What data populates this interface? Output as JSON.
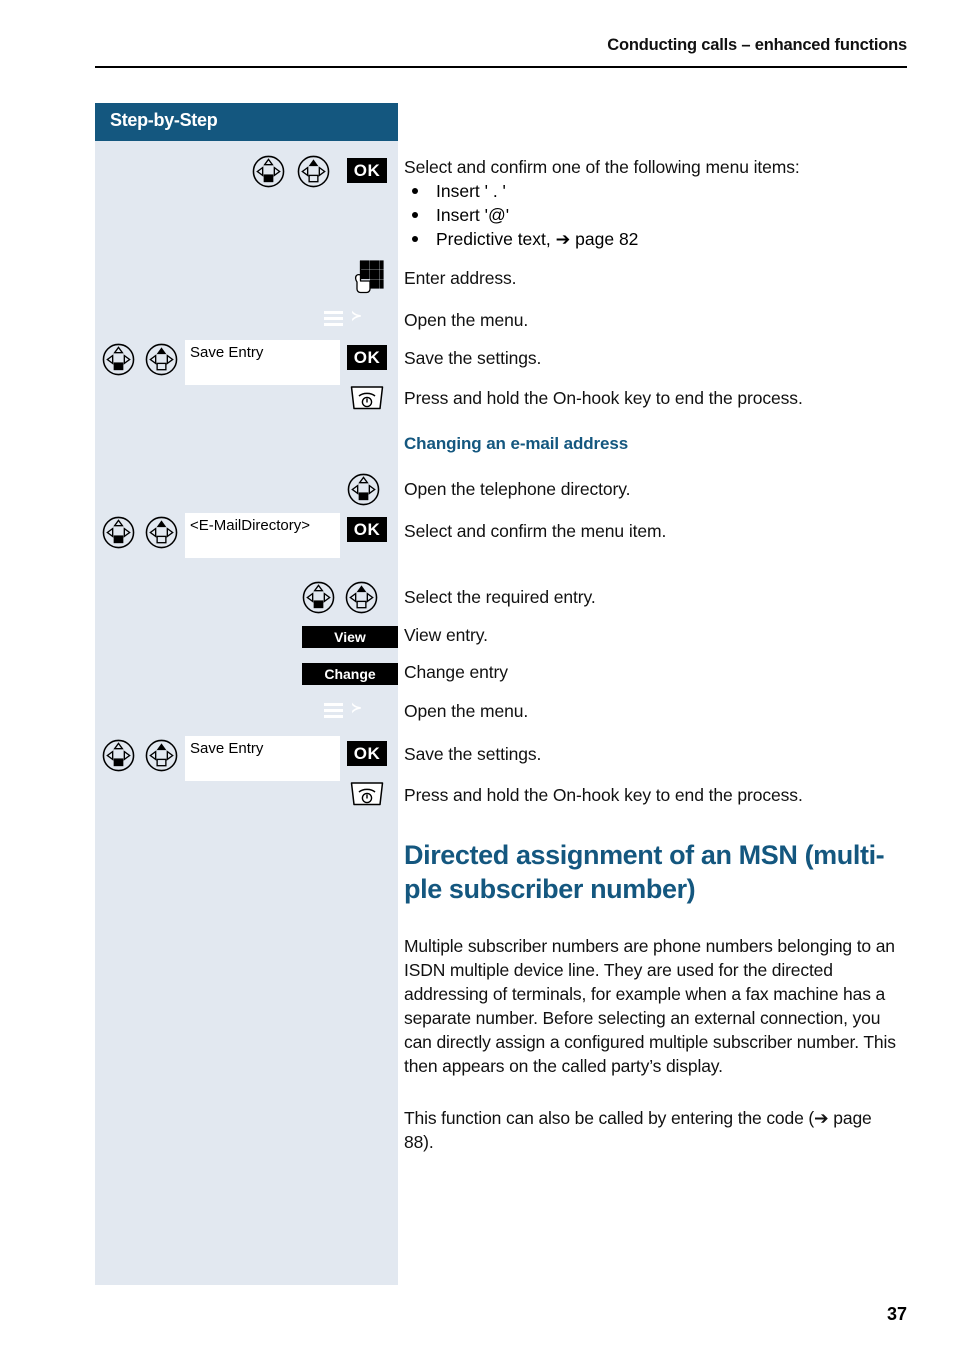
{
  "header": {
    "running_title": "Conducting calls – enhanced functions"
  },
  "sidebar": {
    "title": "Step-by-Step",
    "rows": [
      {
        "icons": [
          "nav-key-outline-up",
          "nav-key-filled-up",
          "ok-key"
        ],
        "display": "",
        "label": "OK"
      },
      {
        "icons": [
          "keypad-key"
        ]
      },
      {
        "icons": [
          "menu-key"
        ]
      },
      {
        "icons": [
          "nav-key-outline-up",
          "nav-key-filled-up",
          "display-field",
          "ok-key"
        ],
        "display": "Save Entry",
        "label": "OK"
      },
      {
        "icons": [
          "on-hook-key"
        ]
      },
      {
        "icons": [
          "nav-key-outline-up"
        ]
      },
      {
        "icons": [
          "nav-key-outline-up",
          "nav-key-filled-up",
          "display-field",
          "ok-key"
        ],
        "display": "<E-MailDirectory>",
        "label": "OK"
      },
      {
        "icons": [
          "nav-key-outline-up",
          "nav-key-filled-up"
        ]
      },
      {
        "icons": [
          "soft-key"
        ],
        "label": "View"
      },
      {
        "icons": [
          "soft-key"
        ],
        "label": "Change"
      },
      {
        "icons": [
          "menu-key"
        ]
      },
      {
        "icons": [
          "nav-key-outline-up",
          "nav-key-filled-up",
          "display-field",
          "ok-key"
        ],
        "display": "Save Entry",
        "label": "OK"
      },
      {
        "icons": [
          "on-hook-key"
        ]
      }
    ],
    "display_save_entry_1": "Save Entry",
    "display_email_directory": "<E-MailDirectory>",
    "display_save_entry_2": "Save Entry",
    "ok_label": "OK",
    "view_label": "View",
    "change_label": "Change",
    "menu_key_glyph": "≻"
  },
  "content": {
    "line_select_confirm": "Select and confirm one of the following menu items:",
    "bullets": [
      "Insert ' . '",
      "Insert '@'",
      "Predictive text, ➔ page 82"
    ],
    "line_enter_address": "Enter address.",
    "line_open_menu_1": "Open the menu.",
    "line_save_settings_1": "Save the settings.",
    "line_onhook_1": "Press and hold the On-hook key to end the process.",
    "heading_changing_email": "Changing an e-mail address",
    "line_open_directory": "Open the telephone directory.",
    "line_select_confirm_menu_item": "Select and confirm the menu item.",
    "line_select_entry": "Select the required entry.",
    "line_view_entry": "View entry.",
    "line_change_entry": "Change entry",
    "line_open_menu_2": "Open the menu.",
    "line_save_settings_2": "Save the settings.",
    "line_onhook_2": "Press and hold the On-hook key to end the process.",
    "heading_msn": "Directed assignment of an MSN (multi-ple subscriber number)",
    "heading_msn_line1": "Directed assignment of an MSN (multi-",
    "heading_msn_line2": "ple subscriber number)",
    "para_msn": "Multiple subscriber numbers are phone numbers belonging to an ISDN multiple device line. They are used for the directed addressing of terminals, for example when a fax machine has a separate number. Before selecting an external connection, you can directly assign a configured multiple subscriber number. This then appears on the called party’s display.",
    "para_code": "This function can also be called by entering the code (➔ page 88)."
  },
  "footer": {
    "page_number": "37"
  },
  "colors": {
    "accent_blue": "#14577f",
    "sidebar_bg": "#e2e8f0",
    "text": "#111111"
  }
}
